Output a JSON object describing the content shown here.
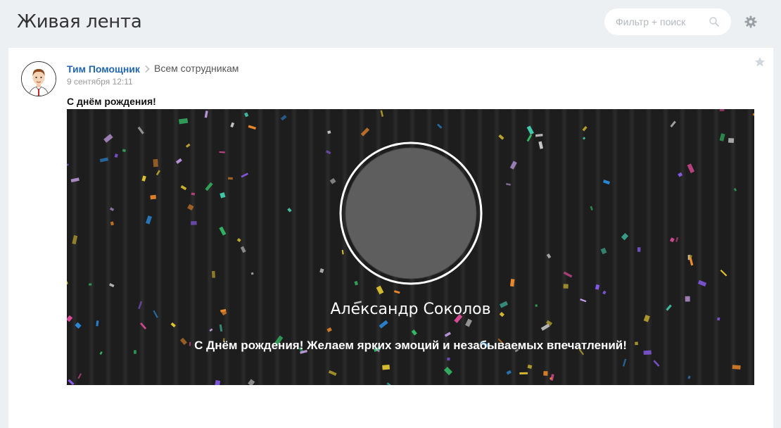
{
  "header": {
    "title": "Живая лента",
    "search": {
      "placeholder": "Фильтр + поиск",
      "value": ""
    }
  },
  "post": {
    "author": "Тим Помощник",
    "recipients": "Всем сотрудникам",
    "date": "9 сентября 12:11",
    "title": "С днём рождения!",
    "banner": {
      "name": "Александр Соколов",
      "message": "С Днём рождения! Желаем ярких эмоций и незабываемых впечатлений!"
    }
  },
  "colors": {
    "accent_link": "#2067b0",
    "page_bg": "#edf0f3",
    "banner_bg": "#1d1d1d",
    "portrait_fill": "#5e5e5e"
  },
  "icons": [
    "search-icon",
    "gear-icon",
    "chevron-right-icon",
    "star-icon"
  ]
}
